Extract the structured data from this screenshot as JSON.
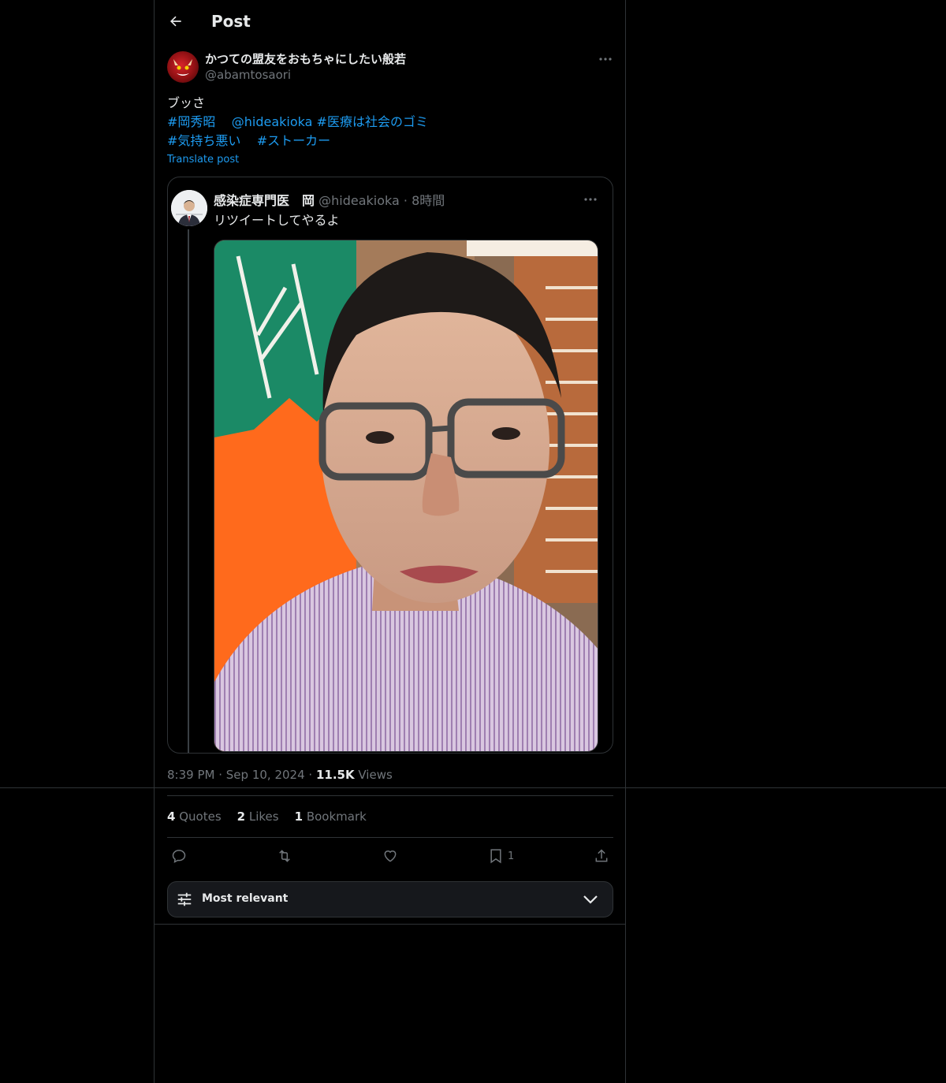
{
  "header": {
    "title": "Post"
  },
  "post": {
    "author_name": "かつての盟友をおもちゃにしたい般若",
    "author_handle": "@abamtosaori",
    "text_line1": "ブッさ",
    "tags_line2": [
      "#岡秀昭",
      "@hideakioka",
      "#医療は社会のゴミ"
    ],
    "tags_line3": [
      "#気持ち悪い",
      "#ストーカー"
    ],
    "translate_label": "Translate post",
    "time": "8:39 PM",
    "date": "Sep 10, 2024",
    "views_count": "11.5K",
    "views_label": "Views"
  },
  "quoted": {
    "name": "感染症専門医　岡",
    "handle": "@hideakioka",
    "age": "8時間",
    "text": "リツイートしてやるよ"
  },
  "stats": {
    "quotes_count": "4",
    "quotes_label": "Quotes",
    "likes_count": "2",
    "likes_label": "Likes",
    "bookmarks_count": "1",
    "bookmarks_label": "Bookmark"
  },
  "actions": {
    "bookmark_count": "1"
  },
  "sort": {
    "label": "Most relevant"
  },
  "colors": {
    "background": "#000000",
    "accent": "#1d9bf0",
    "border": "#2f3336",
    "muted": "#71767b"
  }
}
